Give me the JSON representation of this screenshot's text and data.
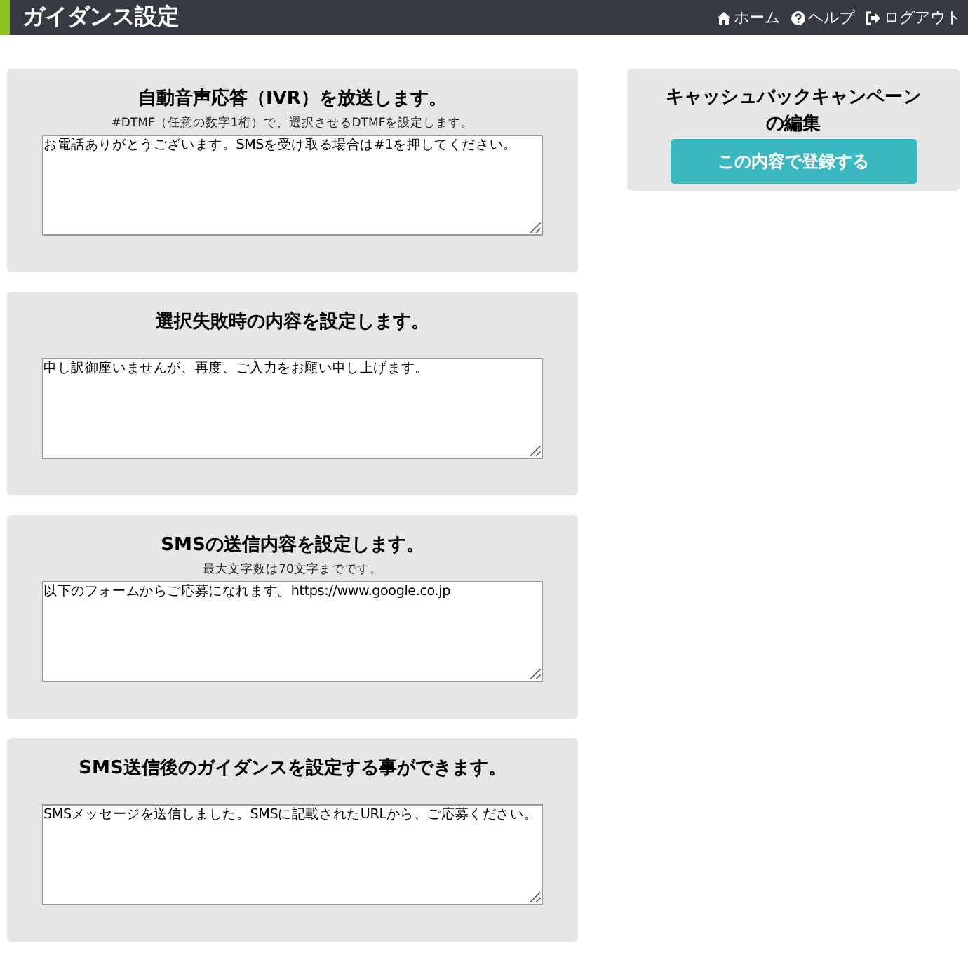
{
  "header": {
    "title": "ガイダンス設定",
    "nav": [
      {
        "kind": "home",
        "label": "ホーム"
      },
      {
        "kind": "help",
        "label": "ヘルプ"
      },
      {
        "kind": "logout",
        "label": "ログアウト"
      }
    ]
  },
  "sections": [
    {
      "heading": "自動音声応答（IVR）を放送します。",
      "note": "#DTMF（任意の数字1桁）で、選択させるDTMFを設定します。",
      "value": "お電話ありがとうございます。SMSを受け取る場合は#1を押してください。"
    },
    {
      "heading": "選択失敗時の内容を設定します。",
      "value": "申し訳御座いませんが、再度、ご入力をお願い申し上げます。"
    },
    {
      "heading": "SMSの送信内容を設定します。",
      "note": "最大文字数は70文字までです。",
      "value": "以下のフォームからご応募になれます。https://www.google.co.jp"
    },
    {
      "heading": "SMS送信後のガイダンスを設定する事ができます。",
      "value": "SMSメッセージを送信しました。SMSに記載されたURLから、ご応募ください。"
    }
  ],
  "side": {
    "title": "キャッシュバックキャンペーンの編集",
    "button": "この内容で登録する"
  }
}
